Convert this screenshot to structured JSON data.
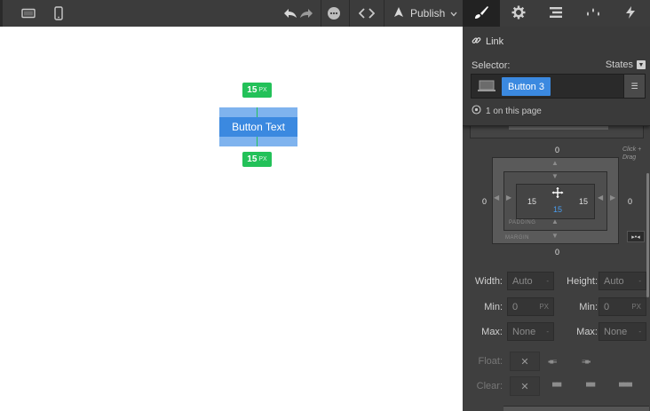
{
  "toolbar": {
    "publish_label": "Publish",
    "icons": [
      "desktop-icon",
      "phone-icon",
      "undo-icon",
      "redo-icon",
      "comment-icon",
      "code-icon",
      "rocket-icon",
      "chevron-down-icon"
    ],
    "tabs": [
      "style-brush-icon",
      "settings-gear-icon",
      "navigator-icon",
      "interactions-drops-icon",
      "lightning-icon"
    ]
  },
  "canvas": {
    "button_text": "Button Text",
    "spacing_top_value": "15",
    "spacing_top_unit": "PX",
    "spacing_bottom_value": "15",
    "spacing_bottom_unit": "PX"
  },
  "panel": {
    "link_label": "Link",
    "selector_label": "Selector:",
    "states_label": "States",
    "class_chip": "Button 3",
    "on_page_text": "1 on this page",
    "box_model": {
      "margin_top": "0",
      "margin_left": "0",
      "margin_right": "0",
      "margin_bottom": "0",
      "padding_left": "15",
      "padding_right": "15",
      "padding_bottom": "15",
      "padding_label": "PADDING",
      "margin_label": "MARGIN",
      "hint": "Click + Drag"
    },
    "size": {
      "width_label": "Width:",
      "width_value": "Auto",
      "height_label": "Height:",
      "height_value": "Auto",
      "min_label": "Min:",
      "min_w_value": "0",
      "min_w_unit": "PX",
      "min_h_label": "Min:",
      "min_h_value": "0",
      "min_h_unit": "PX",
      "max_label": "Max:",
      "max_w_value": "None",
      "max_h_label": "Max:",
      "max_h_value": "None",
      "dash": "-"
    },
    "float_label": "Float:",
    "clear_label": "Clear:",
    "x_symbol": "✕"
  },
  "colors": {
    "accent_blue": "#3b89e0",
    "spacing_green": "#23c159",
    "panel_bg": "#3f3f3f",
    "toolbar_bg": "#3c3c3c"
  }
}
